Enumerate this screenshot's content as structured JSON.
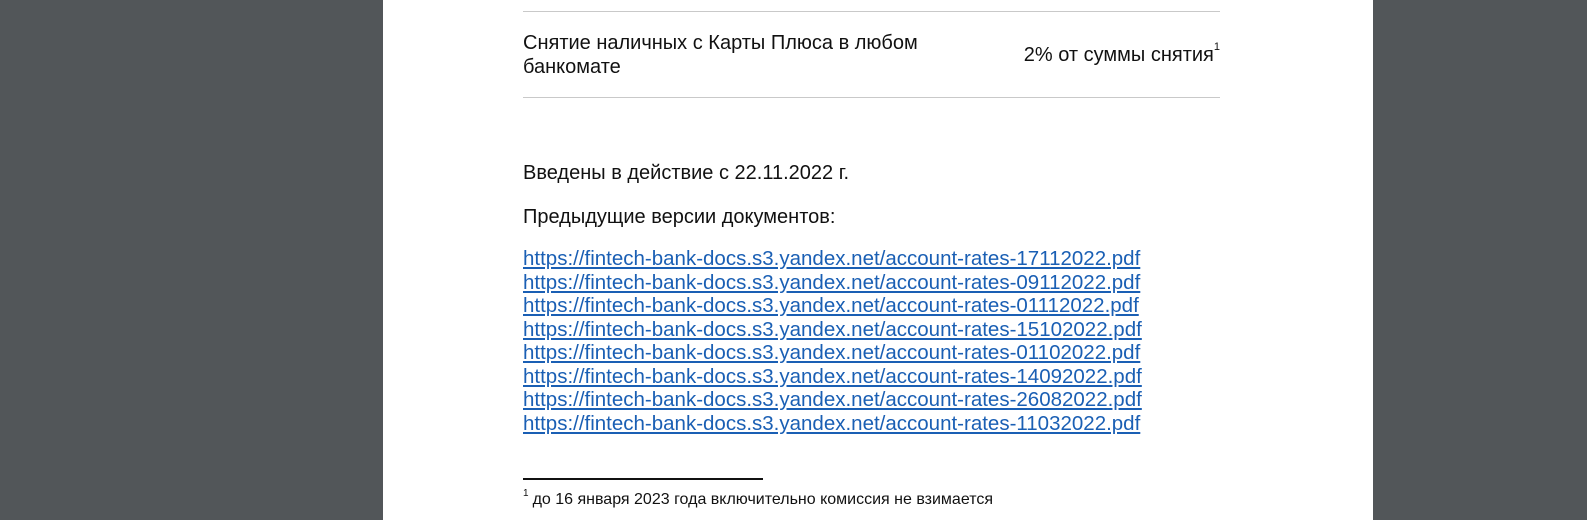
{
  "fee_table": {
    "row": {
      "name": "Снятие наличных с Карты Плюса в любом банкомате",
      "value": "2% от суммы снятия",
      "footnote_marker": "1"
    }
  },
  "effective_date_text": "Введены в действие с 22.11.2022 г.",
  "previous_versions": {
    "title": "Предыдущие версии документов:",
    "links": [
      "https://fintech-bank-docs.s3.yandex.net/account-rates-17112022.pdf",
      "https://fintech-bank-docs.s3.yandex.net/account-rates-09112022.pdf",
      "https://fintech-bank-docs.s3.yandex.net/account-rates-01112022.pdf",
      "https://fintech-bank-docs.s3.yandex.net/account-rates-15102022.pdf",
      "https://fintech-bank-docs.s3.yandex.net/account-rates-01102022.pdf",
      "https://fintech-bank-docs.s3.yandex.net/account-rates-14092022.pdf",
      "https://fintech-bank-docs.s3.yandex.net/account-rates-26082022.pdf",
      "https://fintech-bank-docs.s3.yandex.net/account-rates-11032022.pdf"
    ]
  },
  "footnote": {
    "marker": "1",
    "text": "до 16 января 2023 года включительно комиссия не взимается"
  },
  "colors": {
    "viewer_background": "#525659",
    "page_background": "#ffffff",
    "link": "#1a5fb4",
    "text": "#111111"
  }
}
